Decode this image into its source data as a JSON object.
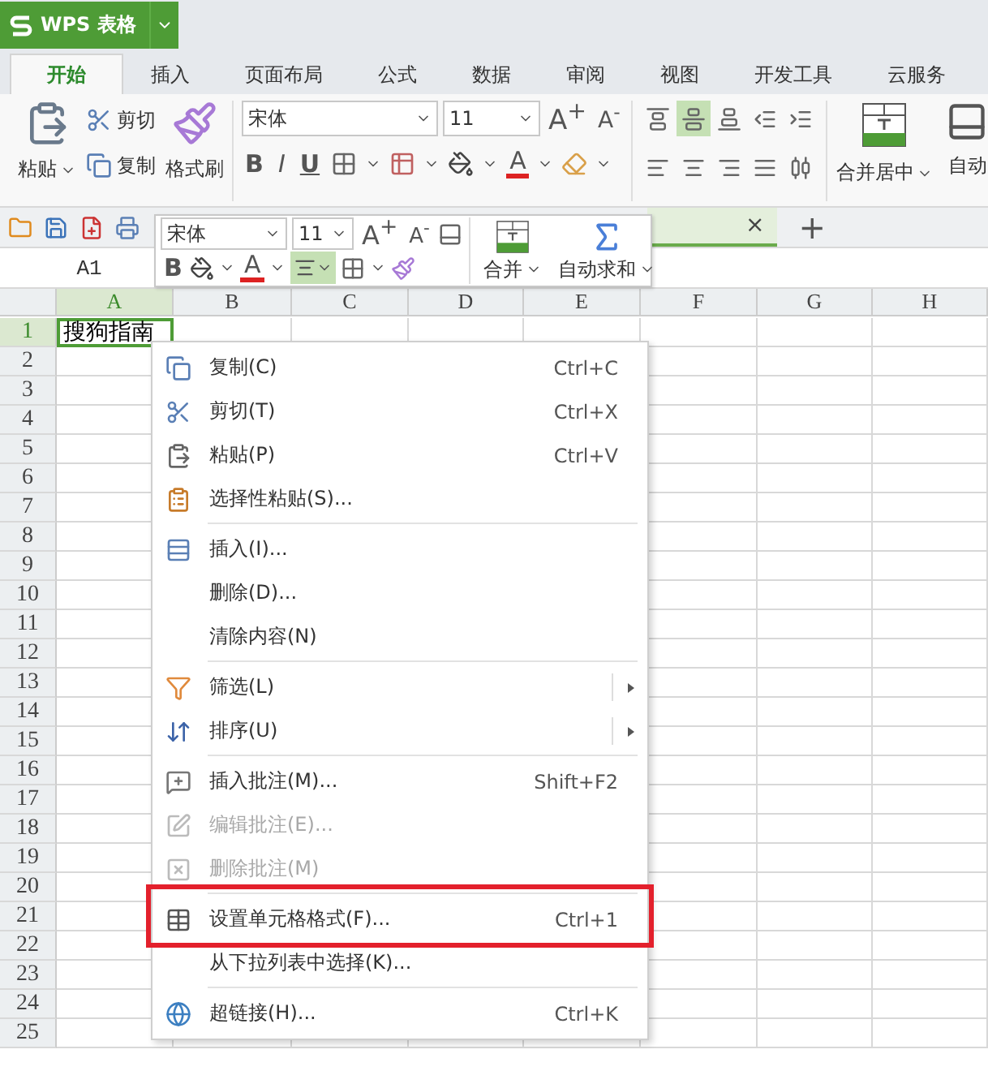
{
  "app_button": {
    "label": "WPS 表格"
  },
  "ribbon_tabs": [
    {
      "label": "开始",
      "selected": true
    },
    {
      "label": "插入",
      "selected": false
    },
    {
      "label": "页面布局",
      "selected": false
    },
    {
      "label": "公式",
      "selected": false
    },
    {
      "label": "数据",
      "selected": false
    },
    {
      "label": "审阅",
      "selected": false
    },
    {
      "label": "视图",
      "selected": false
    },
    {
      "label": "开发工具",
      "selected": false
    },
    {
      "label": "云服务",
      "selected": false
    }
  ],
  "clipboard": {
    "paste": "粘贴",
    "cut": "剪切",
    "copy": "复制",
    "format_painter": "格式刷"
  },
  "font": {
    "name": "宋体",
    "size": "11",
    "grow": "A$^{+}$",
    "shrink": "A$^{-}$",
    "bold": "B",
    "italic": "I",
    "underline": "U",
    "font_color": "A"
  },
  "alignment": [
    {
      "kind": "top",
      "selected": false
    },
    {
      "kind": "middle",
      "selected": true
    },
    {
      "kind": "bottom",
      "selected": false
    },
    {
      "kind": "outdent",
      "selected": false
    },
    {
      "kind": "indent",
      "selected": false
    },
    {
      "kind": "left",
      "selected": false
    },
    {
      "kind": "center",
      "selected": false
    },
    {
      "kind": "right",
      "selected": false
    },
    {
      "kind": "justify",
      "selected": false
    },
    {
      "kind": "distributed",
      "selected": false
    }
  ],
  "merge": {
    "label": "合并居中"
  },
  "wrap": {
    "label": "自动"
  },
  "document_tabs": {
    "close": "×",
    "add": "+"
  },
  "formula_bar": {
    "cell_ref": "A1"
  },
  "sheet": {
    "columns": [
      {
        "label": "A",
        "selected": true
      },
      {
        "label": "B",
        "selected": false
      },
      {
        "label": "C",
        "selected": false
      },
      {
        "label": "D",
        "selected": false
      },
      {
        "label": "E",
        "selected": false
      },
      {
        "label": "F",
        "selected": false
      },
      {
        "label": "G",
        "selected": false
      },
      {
        "label": "H",
        "selected": false
      }
    ],
    "rows": [
      {
        "label": "1",
        "selected": true
      },
      {
        "label": "2",
        "selected": false
      },
      {
        "label": "3",
        "selected": false
      },
      {
        "label": "4",
        "selected": false
      },
      {
        "label": "5",
        "selected": false
      },
      {
        "label": "6",
        "selected": false
      },
      {
        "label": "7",
        "selected": false
      },
      {
        "label": "8",
        "selected": false
      },
      {
        "label": "9",
        "selected": false
      },
      {
        "label": "10",
        "selected": false
      },
      {
        "label": "11",
        "selected": false
      },
      {
        "label": "12",
        "selected": false
      },
      {
        "label": "13",
        "selected": false
      },
      {
        "label": "14",
        "selected": false
      },
      {
        "label": "15",
        "selected": false
      },
      {
        "label": "16",
        "selected": false
      },
      {
        "label": "17",
        "selected": false
      },
      {
        "label": "18",
        "selected": false
      },
      {
        "label": "19",
        "selected": false
      },
      {
        "label": "20",
        "selected": false
      },
      {
        "label": "21",
        "selected": false
      },
      {
        "label": "22",
        "selected": false
      },
      {
        "label": "23",
        "selected": false
      },
      {
        "label": "24",
        "selected": false
      },
      {
        "label": "25",
        "selected": false
      }
    ],
    "active_cell_value": "搜狗指南"
  },
  "mini_toolbar": {
    "font": "宋体",
    "size": "11",
    "grow": "A$^{+}$",
    "shrink": "A$^{-}$",
    "bold": "B",
    "font_color": "A",
    "align_selected": true,
    "merge": "合并",
    "autosum": "自动求和"
  },
  "context_menu": {
    "items": [
      {
        "kind": "copy",
        "label": "复制(C)",
        "shortcut": "Ctrl+C",
        "separator_before": false,
        "submenu": false,
        "disabled": false,
        "highlighted": false
      },
      {
        "kind": "cut",
        "label": "剪切(T)",
        "shortcut": "Ctrl+X",
        "separator_before": false,
        "submenu": false,
        "disabled": false,
        "highlighted": false
      },
      {
        "kind": "paste",
        "label": "粘贴(P)",
        "shortcut": "Ctrl+V",
        "separator_before": false,
        "submenu": false,
        "disabled": false,
        "highlighted": false
      },
      {
        "kind": "paste-special",
        "label": "选择性粘贴(S)...",
        "separator_before": false,
        "submenu": false,
        "disabled": false,
        "highlighted": false
      },
      {
        "kind": "insert",
        "label": "插入(I)...",
        "separator_before": true,
        "submenu": false,
        "disabled": false,
        "highlighted": false
      },
      {
        "kind": "none",
        "label": "删除(D)...",
        "separator_before": false,
        "submenu": false,
        "disabled": false,
        "highlighted": false
      },
      {
        "kind": "none",
        "label": "清除内容(N)",
        "separator_before": false,
        "submenu": false,
        "disabled": false,
        "highlighted": false
      },
      {
        "kind": "filter",
        "label": "筛选(L)",
        "separator_before": true,
        "submenu": true,
        "disabled": false,
        "highlighted": false
      },
      {
        "kind": "sort",
        "label": "排序(U)",
        "separator_before": false,
        "submenu": true,
        "disabled": false,
        "highlighted": false
      },
      {
        "kind": "comment-add",
        "label": "插入批注(M)...",
        "shortcut": "Shift+F2",
        "separator_before": true,
        "submenu": false,
        "disabled": false,
        "highlighted": false
      },
      {
        "kind": "comment-edit",
        "label": "编辑批注(E)...",
        "separator_before": false,
        "submenu": false,
        "disabled": true,
        "highlighted": false
      },
      {
        "kind": "comment-delete",
        "label": "删除批注(M)",
        "separator_before": false,
        "submenu": false,
        "disabled": true,
        "highlighted": false
      },
      {
        "kind": "format",
        "label": "设置单元格格式(F)...",
        "shortcut": "Ctrl+1",
        "separator_before": true,
        "submenu": false,
        "disabled": false,
        "highlighted": true
      },
      {
        "kind": "none",
        "label": "从下拉列表中选择(K)...",
        "separator_before": false,
        "submenu": false,
        "disabled": false,
        "highlighted": false
      },
      {
        "kind": "link",
        "label": "超链接(H)...",
        "shortcut": "Ctrl+K",
        "separator_before": true,
        "submenu": false,
        "disabled": false,
        "highlighted": false
      }
    ]
  }
}
